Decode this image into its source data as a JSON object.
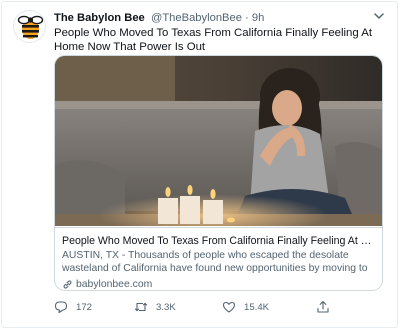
{
  "tweet": {
    "author_name": "The Babylon Bee",
    "author_handle": "@TheBabylonBee",
    "separator": " · ",
    "time": "9h",
    "text": "People Who Moved To Texas From California Finally Feeling At Home Now That Power Is Out"
  },
  "card": {
    "image_icon": "photo-woman-candles",
    "title": "People Who Moved To Texas From California Finally Feeling At Home N...",
    "description": "AUSTIN, TX - Thousands of people who escaped the desolate wasteland of California have found new opportunities by moving to Texas. To help ...",
    "domain": "babylonbee.com"
  },
  "actions": {
    "reply_count": "172",
    "retweet_count": "3.3K",
    "like_count": "15.4K"
  },
  "icons": {
    "avatar": "babylon-bee-logo-icon",
    "more": "chevron-down-icon",
    "reply": "reply-icon",
    "retweet": "retweet-icon",
    "like": "heart-icon",
    "share": "share-icon",
    "link": "link-icon"
  },
  "colors": {
    "text": "#0f1419",
    "secondary": "#536471",
    "border": "#cfd9de",
    "logo_orange": "#f7a31c"
  }
}
